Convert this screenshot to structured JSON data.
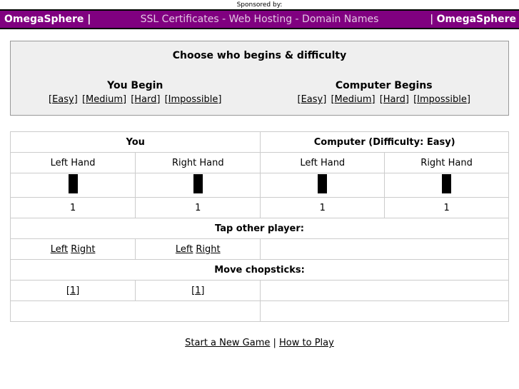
{
  "sponsor": {
    "label": "Sponsored by:",
    "banner_left": "OmegaSphere |",
    "banner_center": "SSL Certificates -  Web Hosting -  Domain Names",
    "banner_right_bar": "| ",
    "banner_right": "OmegaSphere",
    "banner_color": "#800080",
    "banner_text_color": "#ffffff",
    "banner_center_color": "#e4c8e4"
  },
  "chooser": {
    "title": "Choose who begins & difficulty",
    "columns": [
      {
        "who": "You Begin",
        "levels": [
          "[Easy]",
          "[Medium]",
          "[Hard]",
          "[Impossible]"
        ]
      },
      {
        "who": "Computer Begins",
        "levels": [
          "[Easy]",
          "[Medium]",
          "[Hard]",
          "[Impossible]"
        ]
      }
    ]
  },
  "game": {
    "player_header": "You",
    "computer_header": "Computer (Difficulty: Easy)",
    "hands": {
      "player_left": "Left Hand",
      "player_right": "Right Hand",
      "computer_left": "Left Hand",
      "computer_right": "Right Hand"
    },
    "counts": {
      "player_left": "1",
      "player_right": "1",
      "computer_left": "1",
      "computer_right": "1"
    },
    "sticks": {
      "player_left": 1,
      "player_right": 1,
      "computer_left": 1,
      "computer_right": 1
    },
    "tap_section_label": "Tap other player:",
    "tap": {
      "player_left": [
        "Left",
        "Right"
      ],
      "player_right": [
        "Left",
        "Right"
      ]
    },
    "move_section_label": "Move chopsticks:",
    "move": {
      "player_left": "[1]",
      "player_right": "[1]"
    },
    "header_bg_you": "#000000",
    "section_bg": "#ababab",
    "border_color": "#cccccc"
  },
  "footer": {
    "new_game": "Start a New Game",
    "separator": " | ",
    "how_to_play": "How to Play"
  }
}
